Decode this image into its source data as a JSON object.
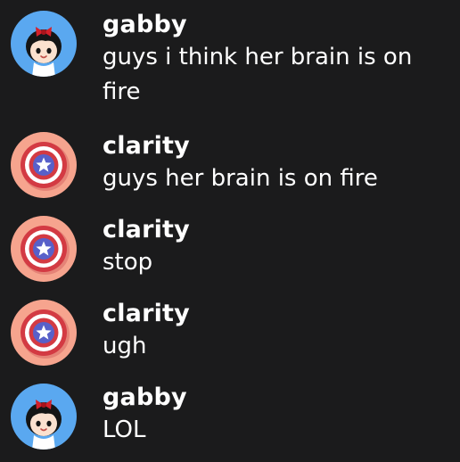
{
  "colors": {
    "background": "#1b1b1c",
    "text": "#ffffff",
    "gabby_avatar_bg": "#5aa8f0",
    "clarity_avatar_bg": "#f6a48e"
  },
  "messages": [
    {
      "username": "gabby",
      "avatar_icon": "girl-with-red-bow-icon",
      "text": "guys i think her brain is on fire"
    },
    {
      "username": "clarity",
      "avatar_icon": "shield-star-icon",
      "text": "guys her brain is on fire"
    },
    {
      "username": "clarity",
      "avatar_icon": "shield-star-icon",
      "text": "stop"
    },
    {
      "username": "clarity",
      "avatar_icon": "shield-star-icon",
      "text": "ugh"
    },
    {
      "username": "gabby",
      "avatar_icon": "girl-with-red-bow-icon",
      "text": "LOL"
    }
  ]
}
